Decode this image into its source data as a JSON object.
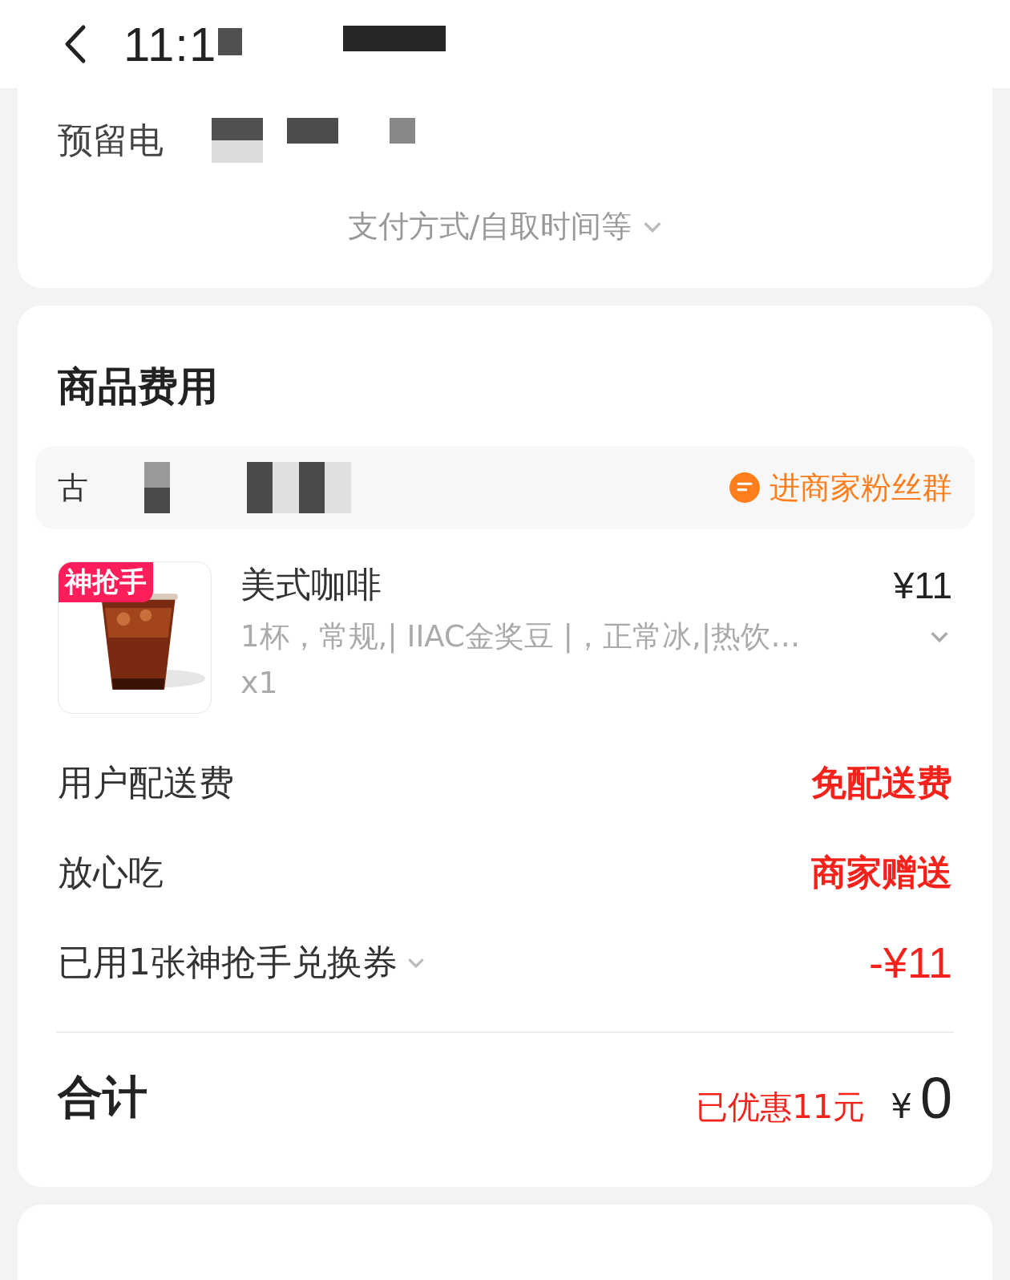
{
  "header": {
    "time": "11:1"
  },
  "contact": {
    "label": "预留电"
  },
  "more": {
    "label": "支付方式/自取时间等"
  },
  "fees": {
    "title": "商品费用",
    "store": {
      "name": "古",
      "fan_group": "进商家粉丝群"
    },
    "item": {
      "badge": "神抢手",
      "name": "美式咖啡",
      "price": "¥11",
      "specs": "1杯，常规,| IIAC金奖豆 |，正常冰,|热饮…",
      "qty": "x1"
    },
    "lines": [
      {
        "label": "用户配送费",
        "value": "免配送费",
        "kind": "plain"
      },
      {
        "label": "放心吃",
        "value": "商家赠送",
        "kind": "plain"
      },
      {
        "label": "已用1张神抢手兑换券",
        "value": "-¥11",
        "kind": "dropdown"
      }
    ],
    "total": {
      "label": "合计",
      "discount": "已优惠11元",
      "currency": "¥",
      "amount": "0"
    }
  }
}
